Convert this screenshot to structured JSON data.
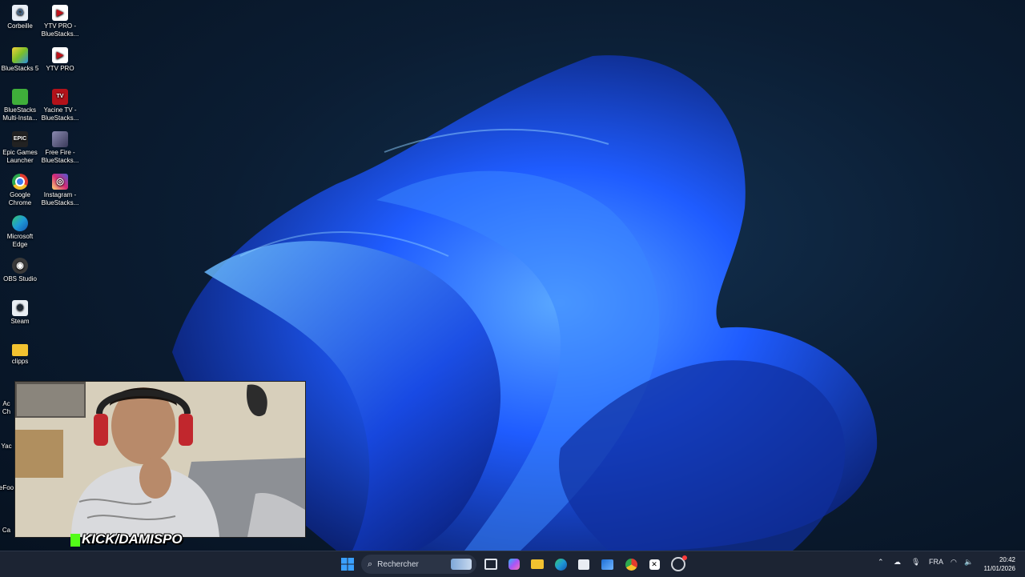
{
  "desktop": {
    "icons": [
      {
        "label": "Corbeille",
        "icon": "recycle-bin-icon",
        "color": "#e8eef6"
      },
      {
        "label": "YTV PRO - BlueStacks...",
        "icon": "ytv-pro-icon",
        "color": "#c0141c"
      },
      {
        "label": "BlueStacks 5",
        "icon": "bluestacks-icon",
        "color": "#7bbf2a"
      },
      {
        "label": "YTV PRO",
        "icon": "ytv-pro-icon",
        "color": "#c0141c"
      },
      {
        "label": "BlueStacks Multi-Insta...",
        "icon": "bluestacks-multi-icon",
        "color": "#3fae3a"
      },
      {
        "label": "Yacine TV - BlueStacks...",
        "icon": "yacine-tv-icon",
        "color": "#b3121a"
      },
      {
        "label": "Epic Games Launcher",
        "icon": "epic-games-icon",
        "color": "#222222"
      },
      {
        "label": "Free Fire - BlueStacks...",
        "icon": "free-fire-icon",
        "color": "#4a4a6a"
      },
      {
        "label": "Google Chrome",
        "icon": "chrome-icon",
        "color": "#e33b2e"
      },
      {
        "label": "Instagram - BlueStacks...",
        "icon": "instagram-icon",
        "color": "#d62976"
      },
      {
        "label": "Microsoft Edge",
        "icon": "edge-icon",
        "color": "#1e9ad6"
      },
      {
        "label": "OBS Studio",
        "icon": "obs-icon",
        "color": "#3a3a3a"
      },
      {
        "label": "Steam",
        "icon": "steam-icon",
        "color": "#1b2838"
      },
      {
        "label": "clipps",
        "icon": "folder-icon",
        "color": "#f2c230"
      }
    ],
    "partial_labels": [
      "Ac",
      "Ch",
      "Yac",
      "eFoo",
      "Ca"
    ]
  },
  "overlay": {
    "kick_text": "KICK/DAMISPO"
  },
  "taskbar": {
    "search_placeholder": "Rechercher",
    "language": "FRA",
    "time": "20:42",
    "date": "11/01/2026",
    "apps": [
      "start-icon",
      "search-icon",
      "widgets-icon",
      "task-view-icon",
      "copilot-icon",
      "file-explorer-icon",
      "edge-icon",
      "store-icon",
      "outlook-icon",
      "chrome-icon",
      "capcut-icon",
      "chrome-profile-icon"
    ]
  },
  "colors": {
    "wallpaper_bloom": "#1a5cff",
    "taskbar_bg": "#1c2433",
    "kick_green": "#53fc18"
  }
}
